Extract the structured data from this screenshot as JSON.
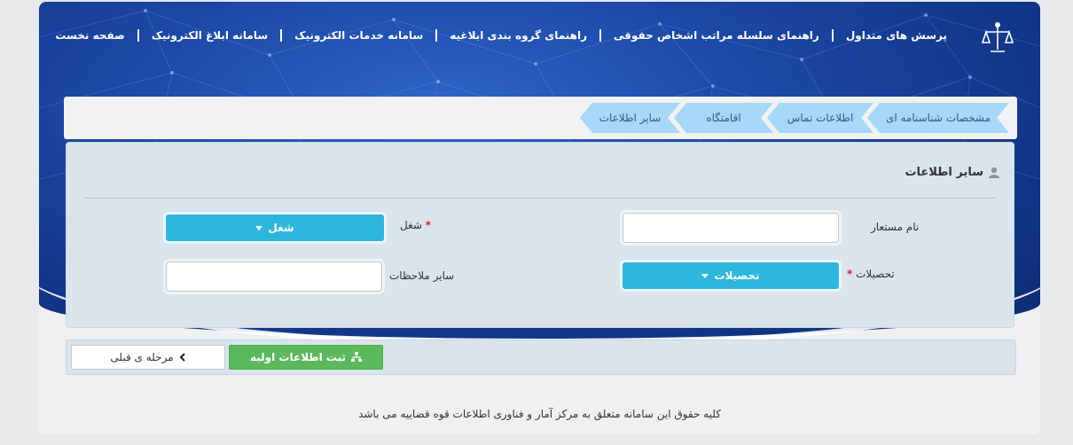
{
  "nav": {
    "items": [
      "صفحه نخست",
      "سامانه ابلاغ الکترونیک",
      "سامانه خدمات الکترونیک",
      "راهنمای گروه بندی ابلاغیه",
      "راهنمای سلسله مراتب اشخاص حقوقی",
      "پرسش های متداول"
    ],
    "logo_icon": "scales-of-justice-icon"
  },
  "steps": [
    "مشخصات شناسنامه ای",
    "اطلاعات تماس",
    "اقامتگاه",
    "سایر اطلاعات"
  ],
  "panel": {
    "title": "سایر اطلاعات",
    "title_icon": "user-icon",
    "fields": {
      "alias_label": "نام مستعار",
      "alias_value": "",
      "job_label": "شغل",
      "job_value": "شغل",
      "education_label": "تحصیلات",
      "education_value": "تحصیلات",
      "notes_label": "سایر ملاحظات",
      "notes_value": "",
      "required_mark": "*"
    }
  },
  "buttons": {
    "submit_label": "ثبت اطلاعات اولیه",
    "submit_icon": "sitemap-icon",
    "prev_label": "مرحله ی قبلی",
    "prev_icon": "chevron-left-icon"
  },
  "footer": {
    "text": "کلیه حقوق این سامانه متعلق به مرکز آمار و فناوری اطلاعات قوه قضاییه می باشد"
  },
  "colors": {
    "hero": "#1d4aa8",
    "step_tab": "#a6d8f8",
    "select": "#2eb7dd",
    "submit": "#5cb85c",
    "panel": "#d9e4ec"
  }
}
